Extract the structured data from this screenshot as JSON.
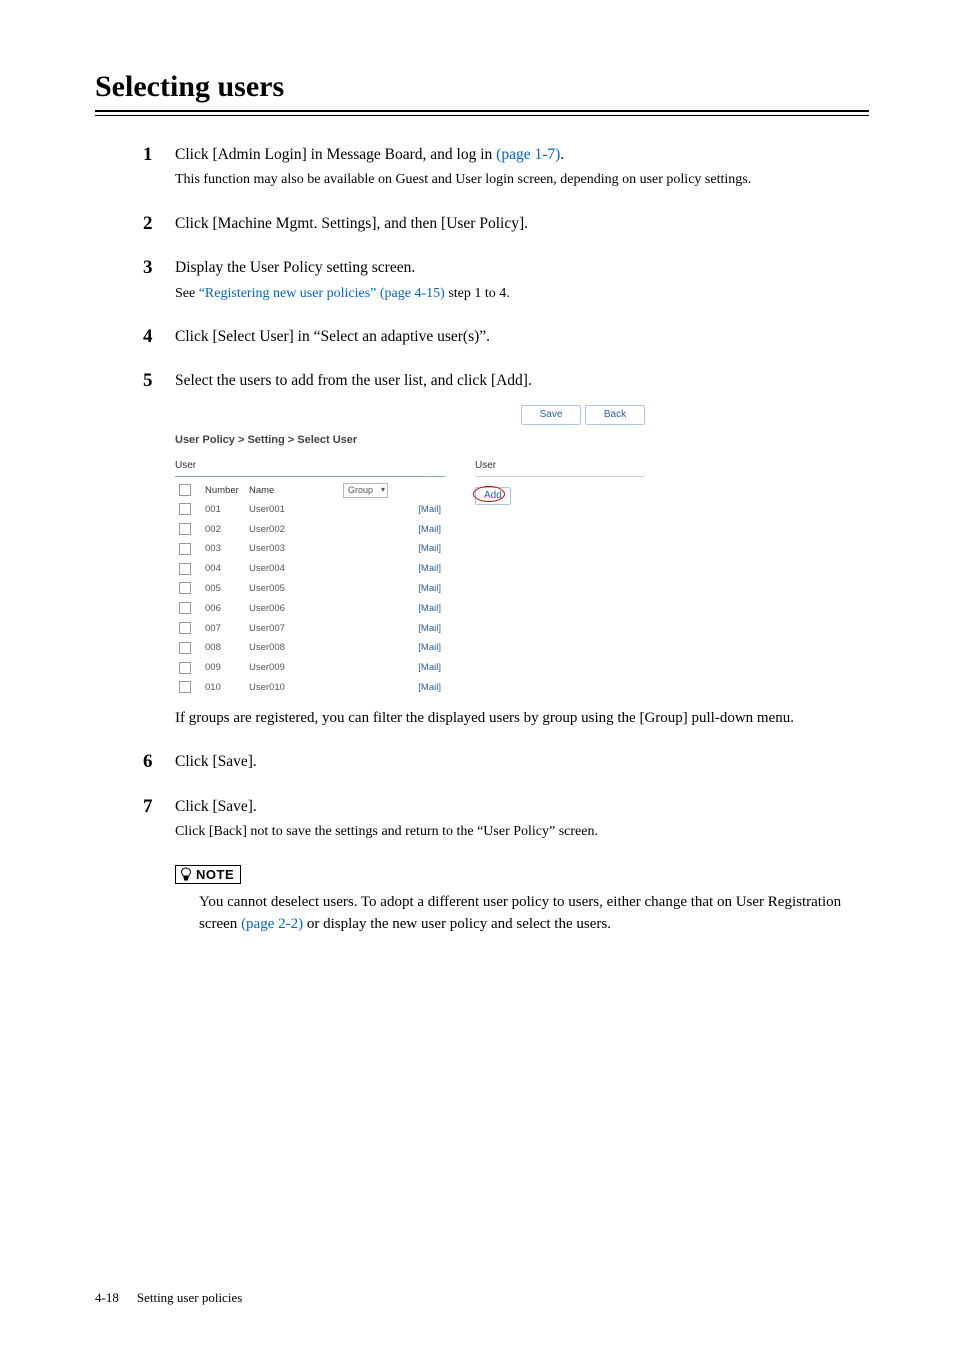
{
  "title": "Selecting users",
  "steps": [
    {
      "main_pre": "Click [Admin Login] in Message Board, and log in ",
      "link": "(page 1-7)",
      "main_post": ".",
      "sub": "This function may also be available on Guest and User login screen, depending on user policy settings."
    },
    {
      "main": "Click [Machine Mgmt. Settings], and then [User Policy]."
    },
    {
      "main": "Display the User Policy setting screen.",
      "sub_pre": "See ",
      "sub_link": "“Registering new user policies” (page 4-15)",
      "sub_post": " step 1 to 4."
    },
    {
      "main": "Click [Select User] in “Select an adaptive user(s)”."
    },
    {
      "main": "Select the users to add from the user list, and click [Add].",
      "post_shot": "If groups are registered, you can filter the displayed users by group using the [Group] pull-down menu."
    },
    {
      "main": "Click [Save]."
    },
    {
      "main": "Click [Save].",
      "sub": "Click [Back] not to save the settings and return to the “User Policy” screen."
    }
  ],
  "shot": {
    "save": "Save",
    "back": "Back",
    "breadcrumb": "User Policy > Setting > Select User",
    "left_head": "User",
    "right_head": "User",
    "col_number": "Number",
    "col_name": "Name",
    "group_label": "Group",
    "add": "Add",
    "mail": "[Mail]",
    "rows": [
      {
        "num": "001",
        "name": "User001"
      },
      {
        "num": "002",
        "name": "User002"
      },
      {
        "num": "003",
        "name": "User003"
      },
      {
        "num": "004",
        "name": "User004"
      },
      {
        "num": "005",
        "name": "User005"
      },
      {
        "num": "006",
        "name": "User006"
      },
      {
        "num": "007",
        "name": "User007"
      },
      {
        "num": "008",
        "name": "User008"
      },
      {
        "num": "009",
        "name": "User009"
      },
      {
        "num": "010",
        "name": "User010"
      }
    ]
  },
  "note": {
    "label": "NOTE",
    "body_pre": "You cannot deselect users.  To adopt a different user policy to users, either change that on User Registration screen ",
    "body_link": "(page 2-2)",
    "body_post": " or display the new user policy and select the users."
  },
  "footer": {
    "page": "4-18",
    "section": "Setting user policies"
  }
}
